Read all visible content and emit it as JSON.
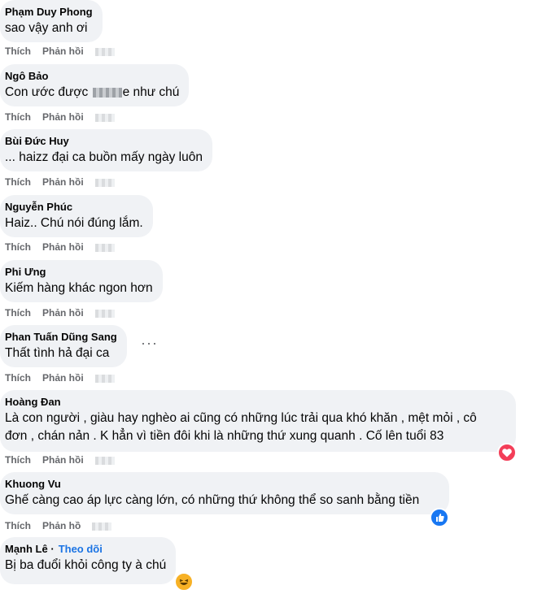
{
  "labels": {
    "like": "Thích",
    "reply": "Phản hồi"
  },
  "comments": [
    {
      "author": "Phạm Duy Phong",
      "text": "sao vậy anh ơi"
    },
    {
      "author": "Ngô Bảo",
      "text_before": "Con ước được",
      "text_after": "e như chú"
    },
    {
      "author": "Bùi Đức Huy",
      "text": "... haizz đại ca buồn mấy ngày luôn"
    },
    {
      "author": "Nguyễn Phúc",
      "text": "Haiz.. Chú nói đúng lắm."
    },
    {
      "author": "Phi Ưng",
      "text": "Kiếm hàng khác ngon hơn"
    },
    {
      "author": "Phan Tuấn Dũng Sang",
      "text": "Thất tình hả đại ca"
    },
    {
      "author": "Hoàng Đan",
      "text_line1": "Là con người , giàu hay nghèo ai cũng có những lúc trải qua khó khăn , mệt mỏi , cô",
      "text_line2": "đơn , chán nản . K hẳn vì tiền đôi khi là những thứ xung quanh . Cố lên tuổi 83",
      "reaction": "love"
    },
    {
      "author": "Khuong Vu",
      "text": "Ghế càng cao áp lực càng lớn, có những thứ không thể so sanh bằng tiền",
      "reaction": "like",
      "reply_label": "Phản hồ"
    },
    {
      "author": "Mạnh Lê",
      "follow_label": "Theo dõi",
      "text": "Bị ba đuổi khỏi công ty à chú",
      "reaction": "haha"
    }
  ],
  "colors": {
    "bubble": "#f0f2f5",
    "link": "#1b74e4",
    "love": "#f33e58",
    "like": "#1877f2",
    "haha": "#f7b125"
  }
}
